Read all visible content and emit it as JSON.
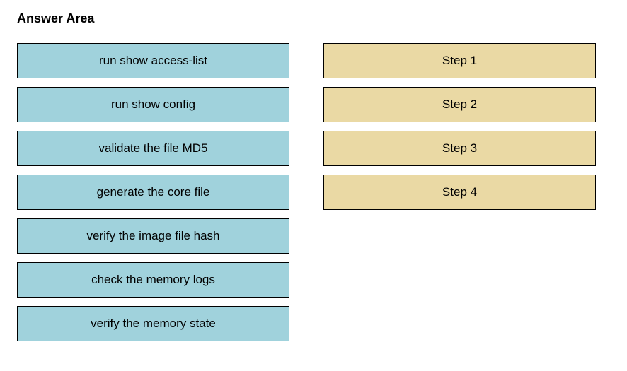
{
  "title": "Answer Area",
  "source_items": [
    "run show access-list",
    "run show config",
    "validate the file MD5",
    "generate the core file",
    "verify the image file hash",
    "check the memory logs",
    "verify the memory state"
  ],
  "target_items": [
    "Step 1",
    "Step 2",
    "Step 3",
    "Step 4"
  ]
}
